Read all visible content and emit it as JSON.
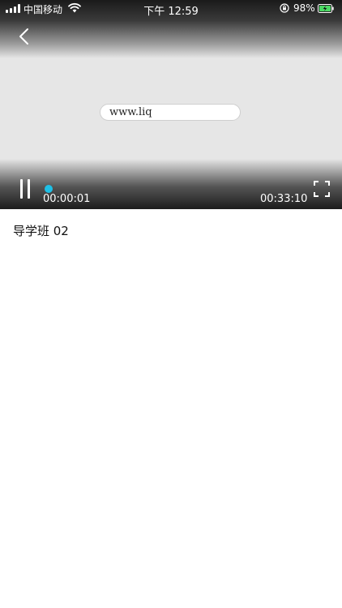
{
  "status_bar": {
    "carrier": "中国移动",
    "time": "下午 12:59",
    "battery_percent": "98%",
    "icons": [
      "signal-icon",
      "wifi-icon",
      "rotation-lock-icon",
      "battery-charging-icon"
    ]
  },
  "player": {
    "url_overlay": "www.liq",
    "current_time": "00:00:01",
    "total_time": "00:33:10",
    "progress_fraction": 0.0005,
    "accent_color": "#1ec0e6",
    "icons": [
      "back-icon",
      "pause-icon",
      "fullscreen-icon"
    ]
  },
  "video": {
    "title": "导学班 02"
  }
}
